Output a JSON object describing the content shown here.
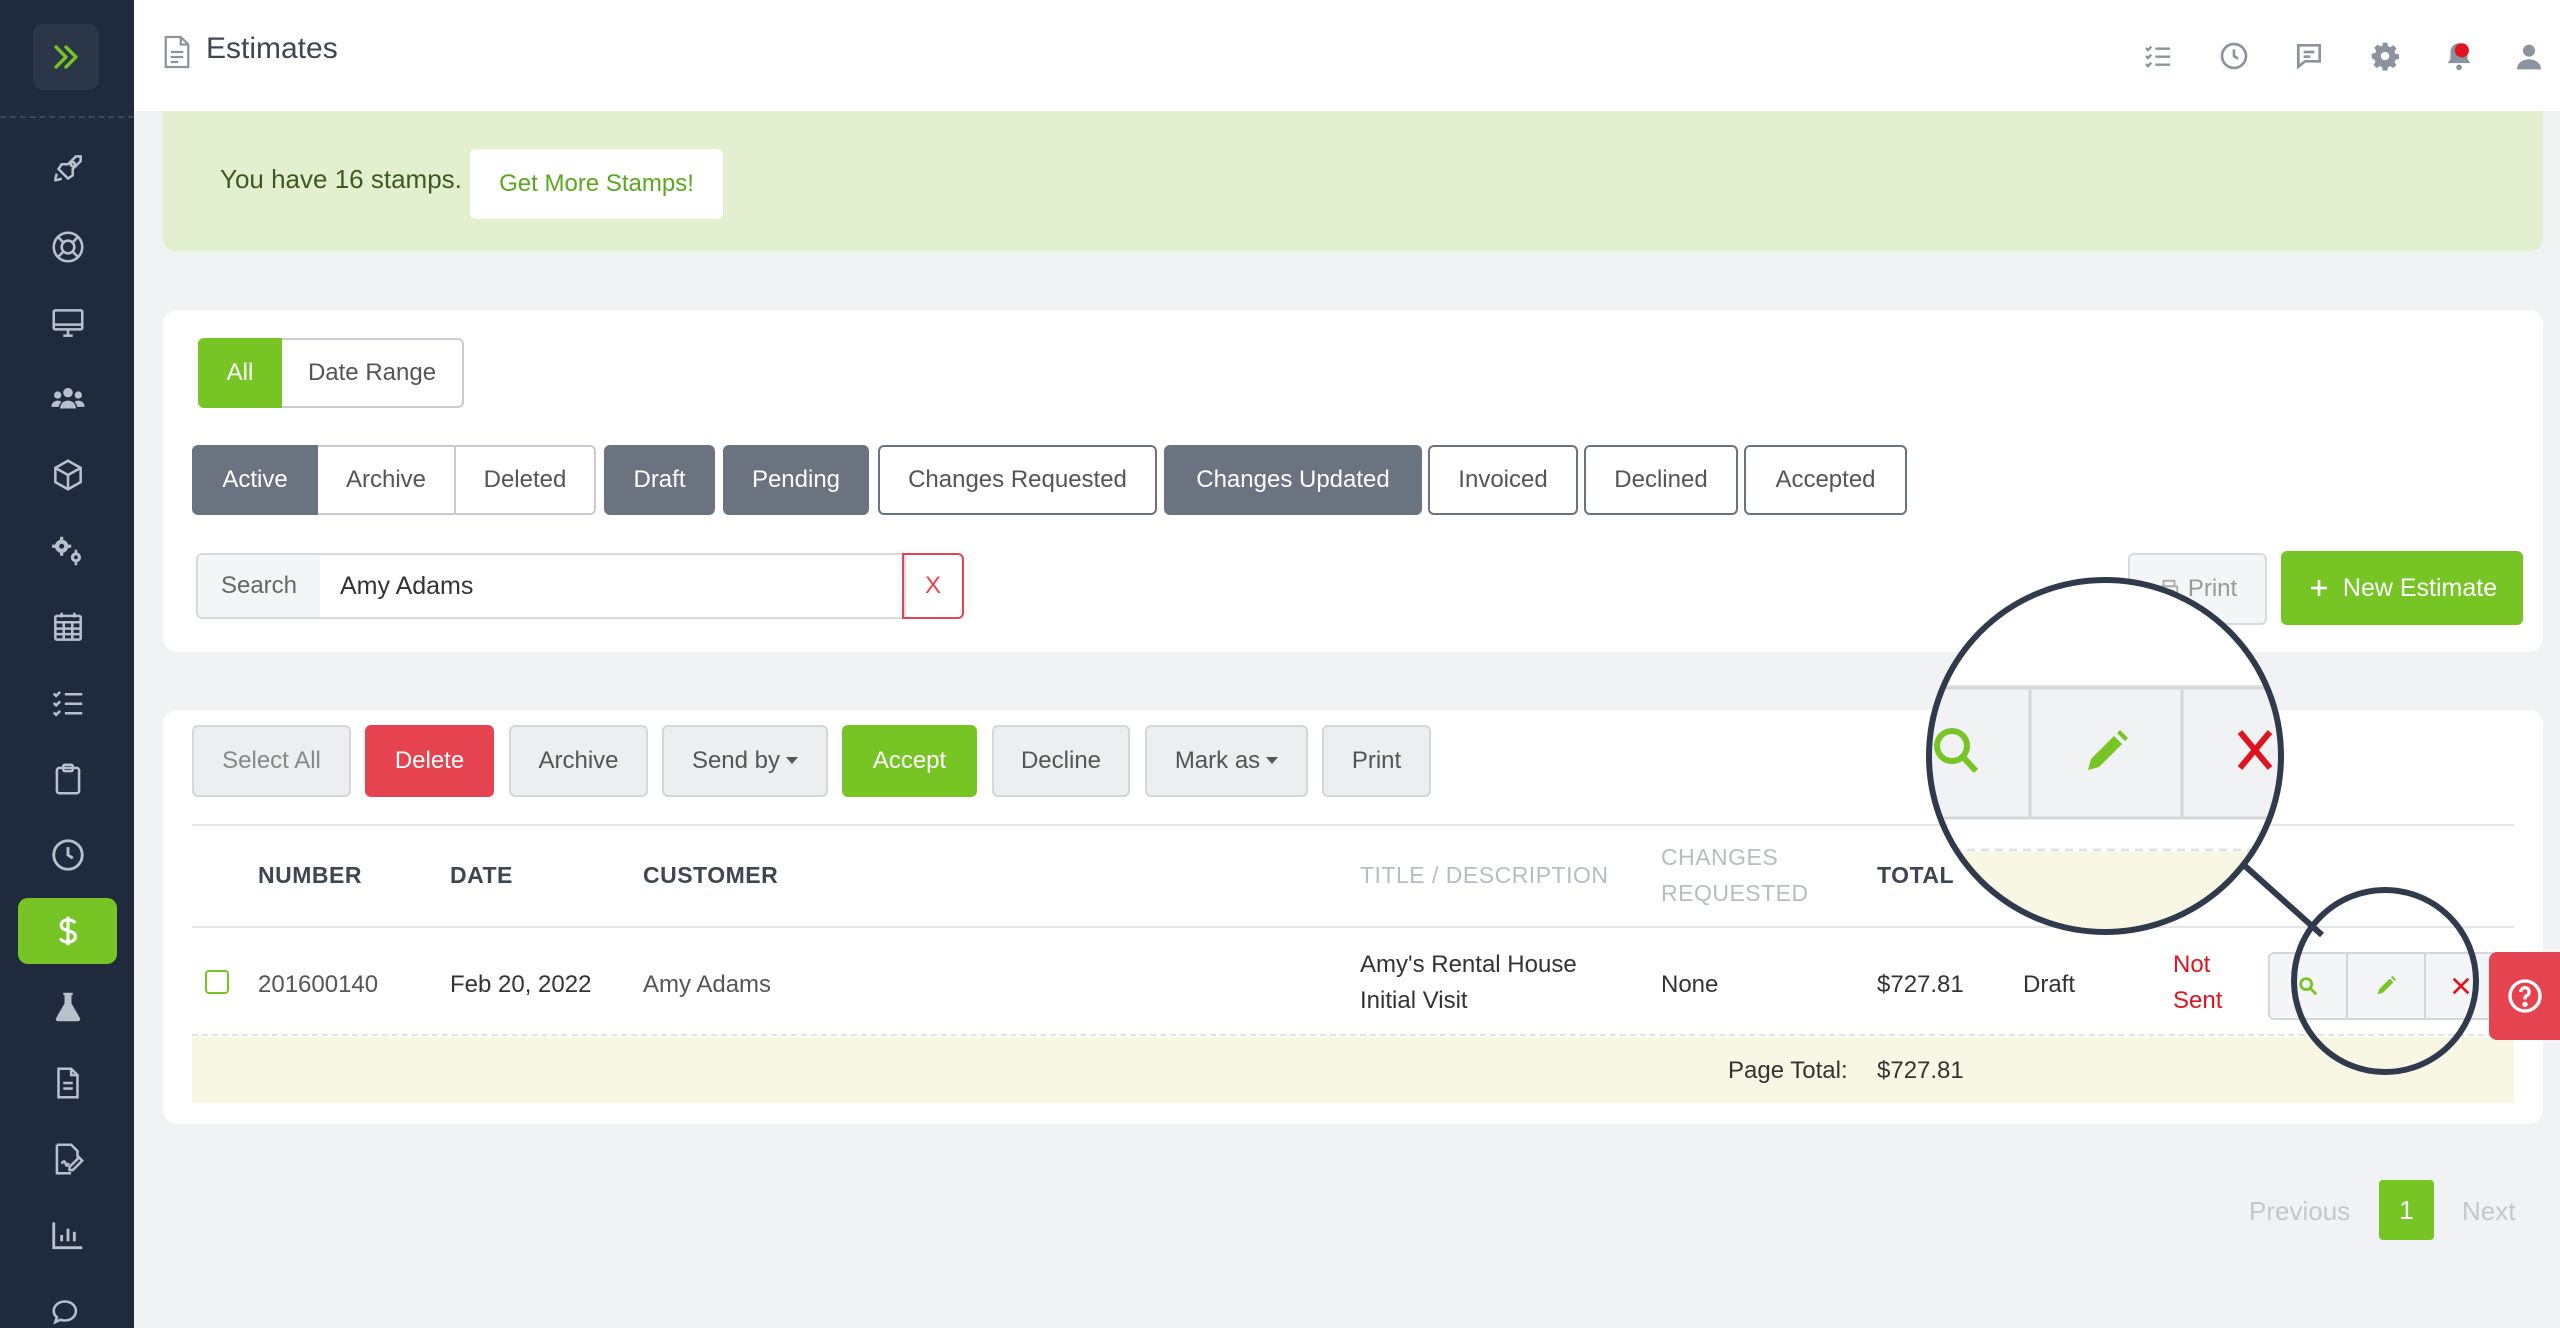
{
  "header": {
    "title": "Estimates"
  },
  "banner": {
    "text": "You have 16 stamps.",
    "button": "Get More Stamps!"
  },
  "range_filter": [
    "All",
    "Date Range"
  ],
  "status_filters": {
    "group1": [
      "Active",
      "Archive",
      "Deleted"
    ],
    "others": [
      "Draft",
      "Pending",
      "Changes Requested",
      "Changes Updated",
      "Invoiced",
      "Declined",
      "Accepted"
    ]
  },
  "search": {
    "label": "Search",
    "value": "Amy Adams",
    "clear": "X"
  },
  "actions": {
    "print": "Print",
    "new_estimate": "New Estimate"
  },
  "bulk": {
    "select_all": "Select All",
    "delete": "Delete",
    "archive": "Archive",
    "send_by": "Send by",
    "accept": "Accept",
    "decline": "Decline",
    "mark_as": "Mark as",
    "print": "Print"
  },
  "table": {
    "headers": {
      "number": "NUMBER",
      "date": "DATE",
      "customer": "CUSTOMER",
      "title": "TITLE / DESCRIPTION",
      "changes_1": "CHANGES",
      "changes_2": "REQUESTED",
      "total": "TOTAL"
    },
    "row": {
      "number": "201600140",
      "date": "Feb 20, 2022",
      "customer": "Amy Adams",
      "title_1": "Amy's Rental House",
      "title_2": "Initial Visit",
      "changes": "None",
      "total": "$727.81",
      "status": "Draft",
      "sent_1": "Not",
      "sent_2": "Sent"
    },
    "page_total_label": "Page Total:",
    "page_total_value": "$727.81"
  },
  "pagination": {
    "previous": "Previous",
    "current": "1",
    "next": "Next"
  },
  "colors": {
    "sidebar": "#1f2a3c",
    "accent_green": "#77c425",
    "danger": "#e5434f",
    "dark_button": "#6b7380"
  }
}
